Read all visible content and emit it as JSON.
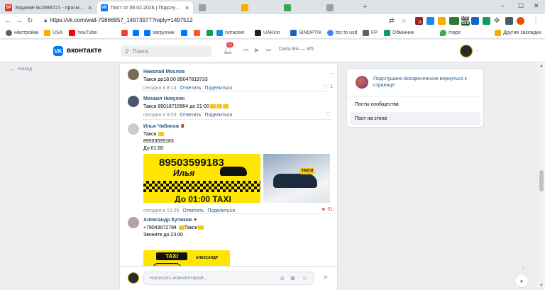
{
  "browser": {
    "tabs": [
      {
        "title": "Задание №2888721 - просмотр з",
        "favicon": "SP",
        "favicon_color": "#d93025",
        "active": false
      },
      {
        "title": "Пост от 06.02.2026 | Подслушано",
        "favicon": "VK",
        "favicon_color": "#0077ff",
        "active": true
      },
      {
        "title": "",
        "favicon": "",
        "favicon_color": "#9aa0a6",
        "active": false
      },
      {
        "title": "",
        "favicon": "",
        "favicon_color": "#f9ab00",
        "active": false
      },
      {
        "title": "",
        "favicon": "",
        "favicon_color": "#34a853",
        "active": false
      },
      {
        "title": "",
        "favicon": "",
        "favicon_color": "#9aa0a6",
        "active": false
      }
    ],
    "url": "https://vk.com/wall-79866957_14973977?reply=1497512",
    "extension_badges": {
      "ext1": "11",
      "ext2": "LTC",
      "ext3": "54.8"
    },
    "bookmarks": [
      {
        "label": "Настройки",
        "icon": "gear-icon",
        "color": "#5f6368"
      },
      {
        "label": "USA",
        "icon": "folder-icon",
        "color": "#f9ab00"
      },
      {
        "label": "YouTube",
        "icon": "youtube-icon",
        "color": "#ff0000"
      },
      {
        "label": "",
        "icon": "gmail-icon",
        "color": "#ea4335"
      },
      {
        "label": "",
        "icon": "vk-icon",
        "color": "#0077ff"
      },
      {
        "label": "загрузчик",
        "icon": "vk-icon",
        "color": "#0077ff"
      },
      {
        "label": "",
        "icon": "vk-icon",
        "color": "#0077ff"
      },
      {
        "label": "",
        "icon": "orange-icon",
        "color": "#ff5722"
      },
      {
        "label": "",
        "icon": "green-icon",
        "color": "#0f9d58"
      },
      {
        "label": "rutracker",
        "icon": "rutracker-icon",
        "color": "#1e88e5"
      },
      {
        "label": "UAKino",
        "icon": "uakino-icon",
        "color": "#202124"
      },
      {
        "label": "SINOPTIK",
        "icon": "sinoptik-icon",
        "color": "#1565c0"
      },
      {
        "label": "btc to usd",
        "icon": "google-icon",
        "color": "#4285f4"
      },
      {
        "label": "FP",
        "icon": "fp-icon",
        "color": "#5f6368"
      },
      {
        "label": "Обмінник",
        "icon": "exchange-icon",
        "color": "#0f9d58"
      },
      {
        "label": "maps",
        "icon": "maps-icon",
        "color": "#34a853"
      }
    ],
    "other_bookmarks": "Другие закладки"
  },
  "vk": {
    "brand": "вконтакте",
    "search_placeholder": "Поиск",
    "notifications_count": "11",
    "track": "Daria Bis — 8/5",
    "back_label": "Назад"
  },
  "comments": [
    {
      "name": "Николай Мослов",
      "text": "Такси до18.00 89047819733",
      "time": "сегодня в 8:14",
      "reply": "Ответить",
      "share": "Поделиться",
      "likes": "1",
      "liked": false,
      "avatar_color": "#7a6a5a"
    },
    {
      "name": "Михаил Никулин",
      "text": "Такси 89018715964 до 21-00",
      "time": "сегодня в 9:03",
      "reply": "Ответить",
      "share": "Поделиться",
      "likes": "",
      "liked": false,
      "avatar_color": "#4a5a6a"
    },
    {
      "name": "Илья Чибисов",
      "text_lines": [
        "Такси",
        "89503599183",
        "До 01:00"
      ],
      "time": "сегодня в 10:05",
      "reply": "Ответить",
      "share": "Поделиться",
      "likes": "91",
      "liked": true,
      "avatar_color": "#c9ccd1",
      "image_text": {
        "phone": "89503599183",
        "name": "Илья",
        "until": "До 01:00 TAXI",
        "sign": "ТАКСИ"
      }
    },
    {
      "name": "Александр Куликов",
      "text_lines": [
        "+79043972784",
        "Такси",
        "Звоните до 23.00"
      ],
      "avatar_color": "#b8a0a8",
      "image_text": {
        "badge": "TAXI",
        "who": "АЛЕКСАНДР"
      }
    }
  ],
  "composer": {
    "placeholder": "Написать комментарий..."
  },
  "sidebar": {
    "group_title": "Подслушано Воскресенское вернуться к странице",
    "items": [
      {
        "label": "Посты сообщества",
        "active": false
      },
      {
        "label": "Пост на стене",
        "active": true
      }
    ]
  }
}
